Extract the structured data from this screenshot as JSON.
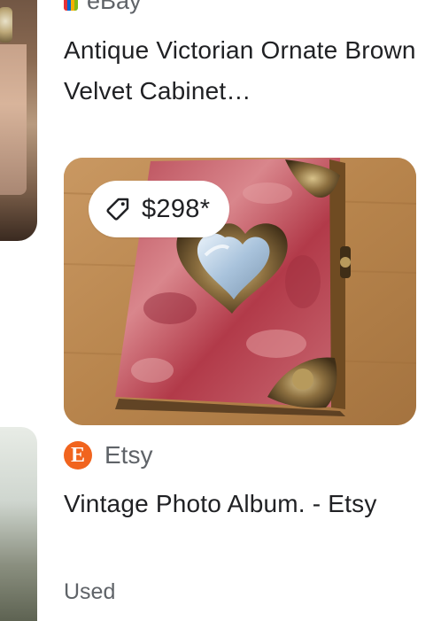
{
  "results": [
    {
      "source": {
        "name": "eBay",
        "icon": "ebay-icon"
      },
      "title": "Antique Victorian Ornate Brown Velvet Cabinet…"
    },
    {
      "price": "$298*",
      "price_icon": "price-tag-icon",
      "source": {
        "name": "Etsy",
        "icon": "etsy-icon",
        "icon_letter": "E",
        "icon_color": "#f1641e"
      },
      "title": "Vintage Photo Album. - Etsy",
      "condition": "Used"
    }
  ],
  "colors": {
    "text_primary": "#202124",
    "text_secondary": "#5f6368"
  }
}
